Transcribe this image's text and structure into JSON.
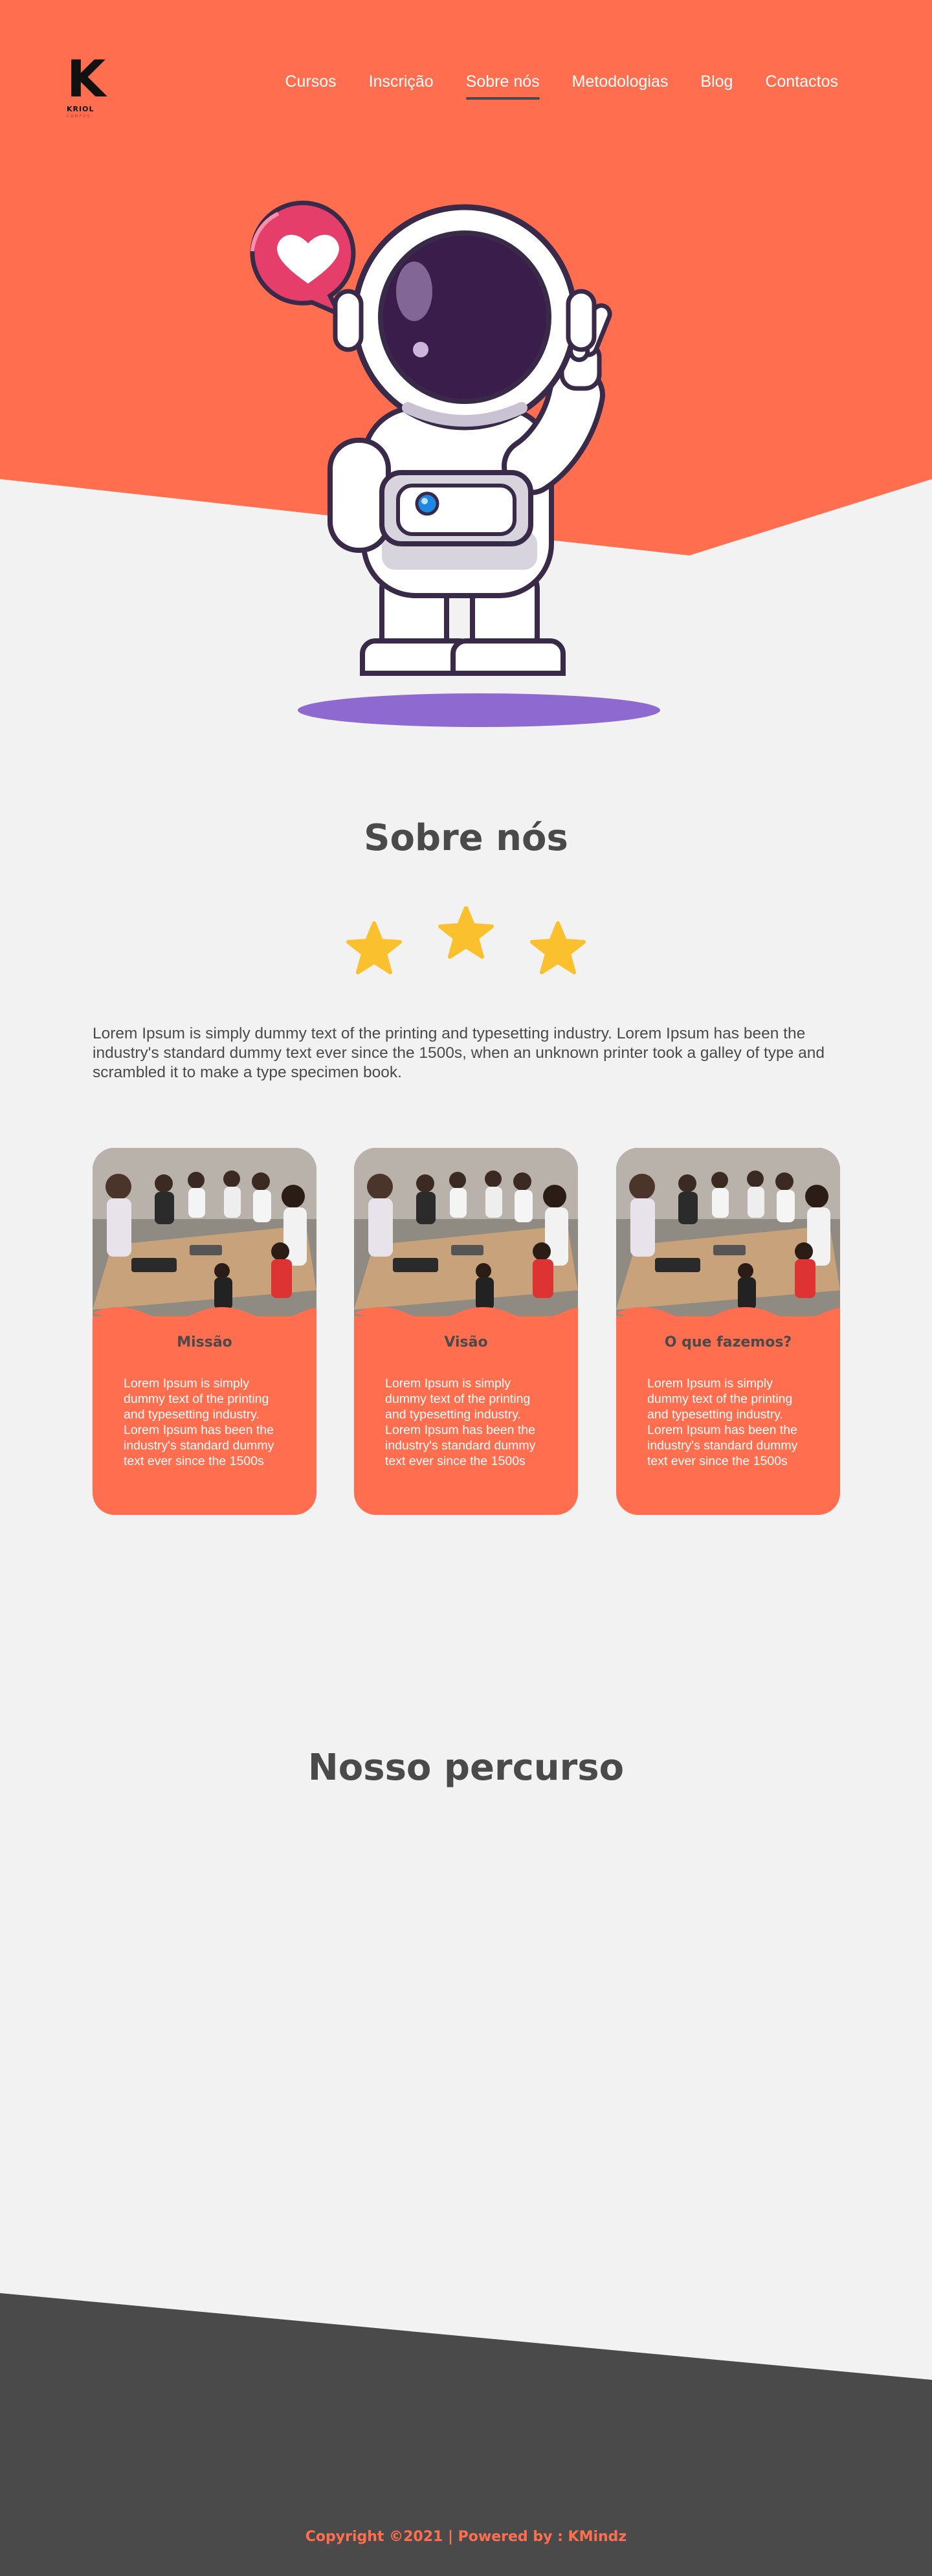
{
  "brand": {
    "logo_letter": "K",
    "logo_word": "KRIOL",
    "logo_sub": "CAMPUS"
  },
  "nav": {
    "items": [
      {
        "label": "Cursos"
      },
      {
        "label": "Inscrição"
      },
      {
        "label": "Sobre nós"
      },
      {
        "label": "Metodologias"
      },
      {
        "label": "Blog"
      },
      {
        "label": "Contactos"
      }
    ],
    "active_index": 2
  },
  "hero": {
    "illustration": "astronaut-peace-sign-with-heart-bubble"
  },
  "about": {
    "title": "Sobre nós",
    "stars": 3,
    "text": "Lorem Ipsum is simply dummy text of the printing and typesetting industry. Lorem Ipsum has been the industry's standard dummy text ever since the 1500s, when an unknown printer took a galley of type and scrambled it to make a type specimen book."
  },
  "cards": [
    {
      "title": "Missão",
      "text": "Lorem Ipsum is simply dummy text of the printing and typesetting industry. Lorem Ipsum has been the industry's standard dummy text ever since the 1500s"
    },
    {
      "title": "Visão",
      "text": "Lorem Ipsum is simply dummy text of the printing and typesetting industry. Lorem Ipsum has been the industry's standard dummy text ever since the 1500s"
    },
    {
      "title": "O que fazemos?",
      "text": "Lorem Ipsum is simply dummy text of the printing and typesetting industry. Lorem Ipsum has been the industry's standard dummy text ever since the 1500s"
    }
  ],
  "journey": {
    "title": "Nosso percurso"
  },
  "footer": {
    "copyright": "Copyright ©2021 | Powered by : KMindz"
  },
  "colors": {
    "primary": "#ff6e4f",
    "dark": "#4a4a4a",
    "background": "#f2f2f2",
    "accent_purple": "#8e6ad0",
    "star": "#fbc02d",
    "heart": "#e53e6b"
  }
}
